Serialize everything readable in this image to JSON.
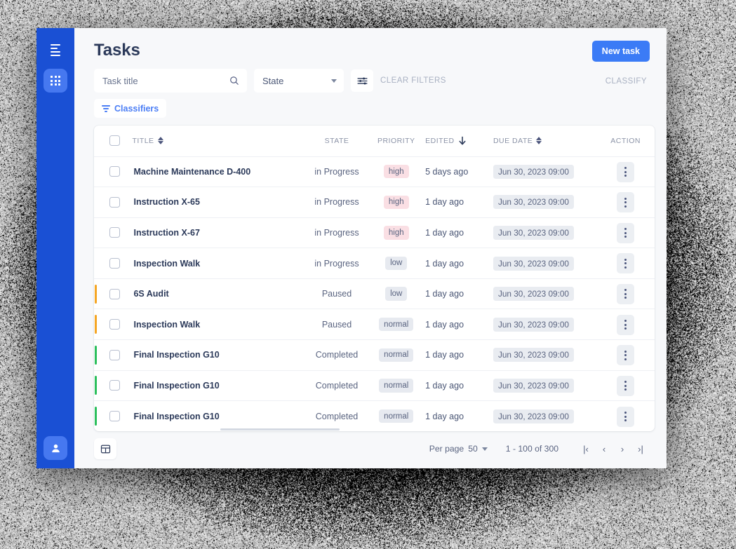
{
  "sidebar": {
    "items": [
      {
        "name": "menu-icon",
        "icon": "menu-icon",
        "active": false
      },
      {
        "name": "apps-grid-icon",
        "icon": "grid-icon",
        "active": true
      }
    ],
    "bottom": [
      {
        "name": "user-account-icon",
        "icon": "user-icon",
        "active": true
      }
    ],
    "bg_color": "#1a50d4",
    "tile_color": "#4678f0"
  },
  "header": {
    "title": "Tasks",
    "new_task_label": "New task",
    "accent_color": "#3b7bf6"
  },
  "toolbar": {
    "search_placeholder": "Task title",
    "search_value": "",
    "search_icon": "search-icon",
    "state_label": "State",
    "state_options": [
      "State"
    ],
    "filter_icon": "sliders-icon",
    "clear_filters_label": "CLEAR FILTERS",
    "classify_label": "CLASSIFY"
  },
  "chips": [
    {
      "label": "Classifiers",
      "icon": "filter-icon",
      "color": "#4b7ef5"
    }
  ],
  "table": {
    "columns": [
      {
        "key": "select",
        "label": "",
        "sortable": false,
        "align": "center"
      },
      {
        "key": "title",
        "label": "TITLE",
        "sortable": true,
        "sort": "none",
        "align": "left"
      },
      {
        "key": "state",
        "label": "STATE",
        "sortable": false,
        "align": "center"
      },
      {
        "key": "priority",
        "label": "PRIORITY",
        "sortable": false,
        "align": "center"
      },
      {
        "key": "edited",
        "label": "EDITED",
        "sortable": true,
        "sort": "desc",
        "align": "left"
      },
      {
        "key": "due",
        "label": "DUE DATE",
        "sortable": true,
        "sort": "none",
        "align": "left"
      },
      {
        "key": "action",
        "label": "ACTION",
        "sortable": false,
        "align": "center"
      }
    ],
    "header_checkbox_checked": false,
    "rows": [
      {
        "bar": "none",
        "checked": false,
        "title": "Machine Maintenance D-400",
        "state": "in Progress",
        "priority": "high",
        "priority_kind": "high",
        "edited": "5 days ago",
        "due": "Jun 30, 2023 09:00"
      },
      {
        "bar": "none",
        "checked": false,
        "title": "Instruction X-65",
        "state": "in Progress",
        "priority": "high",
        "priority_kind": "high",
        "edited": "1 day ago",
        "due": "Jun 30, 2023 09:00"
      },
      {
        "bar": "none",
        "checked": false,
        "title": "Instruction X-67",
        "state": "in Progress",
        "priority": "high",
        "priority_kind": "high",
        "edited": "1 day ago",
        "due": "Jun 30, 2023 09:00"
      },
      {
        "bar": "none",
        "checked": false,
        "title": "Inspection Walk",
        "state": "in Progress",
        "priority": "low",
        "priority_kind": "low",
        "edited": "1 day ago",
        "due": "Jun 30, 2023 09:00"
      },
      {
        "bar": "orange",
        "checked": false,
        "title": "6S Audit",
        "state": "Paused",
        "priority": "low",
        "priority_kind": "low",
        "edited": "1 day ago",
        "due": "Jun 30, 2023 09:00"
      },
      {
        "bar": "orange",
        "checked": false,
        "title": "Inspection Walk",
        "state": "Paused",
        "priority": "normal",
        "priority_kind": "normal",
        "edited": "1 day ago",
        "due": "Jun 30, 2023 09:00"
      },
      {
        "bar": "green",
        "checked": false,
        "title": "Final Inspection G10",
        "state": "Completed",
        "priority": "normal",
        "priority_kind": "normal",
        "edited": "1 day ago",
        "due": "Jun 30, 2023 09:00"
      },
      {
        "bar": "green",
        "checked": false,
        "title": "Final Inspection G10",
        "state": "Completed",
        "priority": "normal",
        "priority_kind": "normal",
        "edited": "1 day ago",
        "due": "Jun 30, 2023 09:00"
      },
      {
        "bar": "green",
        "checked": false,
        "title": "Final Inspection G10",
        "state": "Completed",
        "priority": "normal",
        "priority_kind": "normal",
        "edited": "1 day ago",
        "due": "Jun 30, 2023 09:00"
      }
    ],
    "bar_colors": {
      "orange": "#f5a623",
      "green": "#2bbf5c",
      "none": "transparent"
    },
    "badge_colors": {
      "high": "#fadfe4",
      "low": "#e7eaf0",
      "normal": "#e7eaf0"
    }
  },
  "footer": {
    "grid_view_icon": "table-view-icon",
    "per_page_label": "Per page",
    "per_page_value": "50",
    "range_label": "1 - 100 of 300",
    "buttons": [
      {
        "name": "first-page-button",
        "glyph": "|‹"
      },
      {
        "name": "prev-page-button",
        "glyph": "‹"
      },
      {
        "name": "next-page-button",
        "glyph": "›"
      },
      {
        "name": "last-page-button",
        "glyph": "›|"
      }
    ]
  }
}
